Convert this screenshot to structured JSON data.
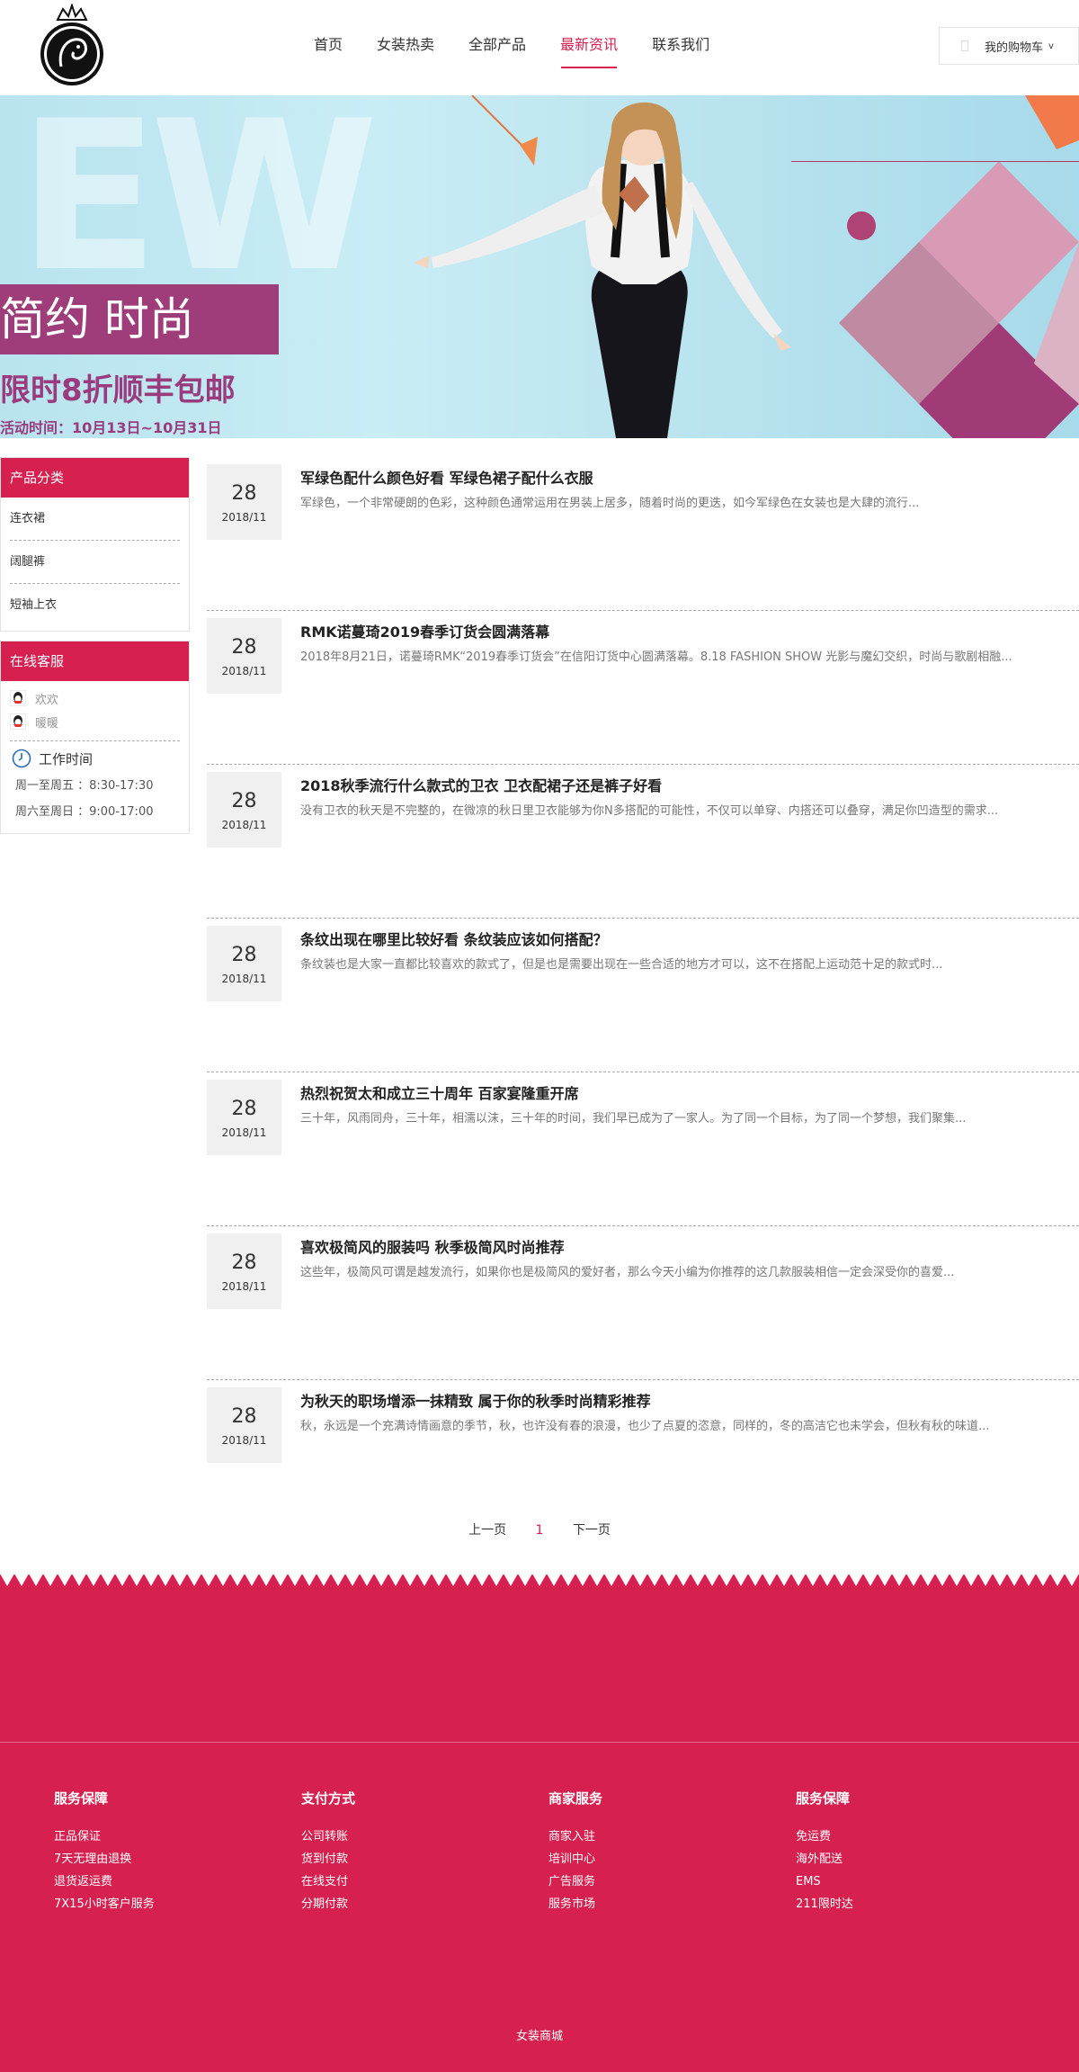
{
  "nav": {
    "items": [
      {
        "label": "首页"
      },
      {
        "label": "女装热卖"
      },
      {
        "label": "全部产品"
      },
      {
        "label": "最新资讯"
      },
      {
        "label": "联系我们"
      }
    ],
    "active": "最新资讯"
  },
  "cart": {
    "label": "我的购物车",
    "chevron": "v"
  },
  "banner": {
    "big_letters": "EW",
    "slogan": "简约  时尚",
    "promo": "限时8折顺丰包邮",
    "date": "活动时间：10月13日~10月31日"
  },
  "sidebar": {
    "category_title": "产品分类",
    "categories": [
      {
        "label": "连衣裙"
      },
      {
        "label": "阔腿裤"
      },
      {
        "label": "短袖上衣"
      }
    ],
    "service_title": "在线客服",
    "services": [
      {
        "label": "欢欢",
        "icon": "qq-icon"
      },
      {
        "label": "暖暖",
        "icon": "qq-icon"
      }
    ],
    "work_title": "工作时间",
    "work_hours": [
      {
        "label": "周一至周五 ：8:30-17:30"
      },
      {
        "label": "周六至周日 ：9:00-17:00"
      }
    ]
  },
  "news": [
    {
      "day": "28",
      "ym": "2018/11",
      "title": "军绿色配什么颜色好看 军绿色裙子配什么衣服",
      "desc": "军绿色，一个非常硬朗的色彩，这种颜色通常运用在男装上居多，随着时尚的更迭，如今军绿色在女装也是大肆的流行..."
    },
    {
      "day": "28",
      "ym": "2018/11",
      "title": "RMK诺蔓琦2019春季订货会圆满落幕",
      "desc": "2018年8月21日，诺蔓琦RMK“2019春季订货会”在信阳订货中心圆满落幕。8.18 FASHION SHOW 光影与魔幻交织，时尚与歌剧相融..."
    },
    {
      "day": "28",
      "ym": "2018/11",
      "title": "2018秋季流行什么款式的卫衣 卫衣配裙子还是裤子好看",
      "desc": "没有卫衣的秋天是不完整的，在微凉的秋日里卫衣能够为你N多搭配的可能性，不仅可以单穿、内搭还可以叠穿，满足你凹造型的需求..."
    },
    {
      "day": "28",
      "ym": "2018/11",
      "title": "条纹出现在哪里比较好看 条纹装应该如何搭配？",
      "desc": "条纹装也是大家一直都比较喜欢的款式了，但是也是需要出现在一些合适的地方才可以，这不在搭配上运动范十足的款式时..."
    },
    {
      "day": "28",
      "ym": "2018/11",
      "title": "热烈祝贺太和成立三十周年 百家宴隆重开席",
      "desc": "三十年，风雨同舟，三十年，相濡以沫，三十年的时间，我们早已成为了一家人。为了同一个目标，为了同一个梦想，我们聚集..."
    },
    {
      "day": "28",
      "ym": "2018/11",
      "title": "喜欢极简风的服装吗 秋季极简风时尚推荐",
      "desc": "这些年，极简风可谓是越发流行，如果你也是极简风的爱好者，那么今天小编为你推荐的这几款服装相信一定会深受你的喜爱..."
    },
    {
      "day": "28",
      "ym": "2018/11",
      "title": "为秋天的职场增添一抹精致 属于你的秋季时尚精彩推荐",
      "desc": "秋，永远是一个充满诗情画意的季节，秋，也许没有春的浪漫，也少了点夏的恣意，同样的，冬的高洁它也未学会，但秋有秋的味道..."
    }
  ],
  "pager": {
    "prev": "上一页",
    "current": "1",
    "next": "下一页"
  },
  "footer": {
    "columns": [
      {
        "title": "服务保障",
        "items": [
          "正品保证",
          "7天无理由退换",
          "退货返运费",
          "7X15小时客户服务"
        ]
      },
      {
        "title": "支付方式",
        "items": [
          "公司转账",
          "货到付款",
          "在线支付",
          "分期付款"
        ]
      },
      {
        "title": "商家服务",
        "items": [
          "商家入驻",
          "培训中心",
          "广告服务",
          "服务市场"
        ]
      },
      {
        "title": "服务保障",
        "items": [
          "免运费",
          "海外配送",
          "EMS",
          "211限时达"
        ]
      }
    ],
    "copyright": "女装商城"
  },
  "colors": {
    "brand": "#d6204f",
    "banner_purple": "#9e3d7a"
  }
}
